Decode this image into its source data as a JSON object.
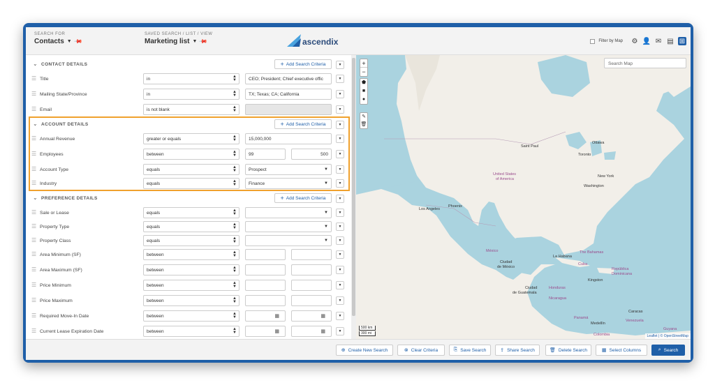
{
  "header": {
    "search_for_label": "SEARCH FOR",
    "search_for_value": "Contacts",
    "saved_search_label": "SAVED SEARCH / LIST / VIEW",
    "saved_search_value": "Marketing list",
    "logo_text": "ascendix",
    "filter_by_map": "Filter by Map"
  },
  "sections": {
    "contact": {
      "title": "CONTACT DETAILS",
      "add": "Add Search Criteria"
    },
    "account": {
      "title": "ACCOUNT DETAILS",
      "add": "Add Search Criteria"
    },
    "preference": {
      "title": "PREFERENCE DETAILS",
      "add": "Add Search Criteria"
    }
  },
  "rows": {
    "title": {
      "label": "Title",
      "op": "in",
      "value": "CEO; President; Chief executive offic"
    },
    "state": {
      "label": "Mailing State/Province",
      "op": "in",
      "value": "TX; Texas; CA; California"
    },
    "email": {
      "label": "Email",
      "op": "is not blank"
    },
    "revenue": {
      "label": "Annual Revenue",
      "op": "greater or equals",
      "value": "15,000,000"
    },
    "employees": {
      "label": "Employees",
      "op": "between",
      "from": "99",
      "to": "500"
    },
    "account_type": {
      "label": "Account Type",
      "op": "equals",
      "value": "Prospect"
    },
    "industry": {
      "label": "Industry",
      "op": "equals",
      "value": "Finance"
    },
    "sale_lease": {
      "label": "Sale or Lease",
      "op": "equals"
    },
    "property_type": {
      "label": "Property Type",
      "op": "equals"
    },
    "property_class": {
      "label": "Property Class",
      "op": "equals"
    },
    "area_min": {
      "label": "Area Minimum (SF)",
      "op": "between"
    },
    "area_max": {
      "label": "Area Maximum (SF)",
      "op": "between"
    },
    "price_min": {
      "label": "Price Minimum",
      "op": "between"
    },
    "price_max": {
      "label": "Price Maximum",
      "op": "between"
    },
    "move_in": {
      "label": "Required Move-In Date",
      "op": "between"
    },
    "lease_exp": {
      "label": "Current Lease Expiration Date",
      "op": "between"
    }
  },
  "map": {
    "search_placeholder": "Search Map",
    "labels": {
      "saint_paul": "Saint Paul",
      "ottawa": "Ottawa",
      "toronto": "Toronto",
      "usa": "United States",
      "usa2": "of America",
      "new_york": "New York",
      "washington": "Washington",
      "los_angeles": "Los Angeles",
      "phoenix": "Phoenix",
      "mexico": "México",
      "la_habana": "La Habana",
      "bahamas": "The Bahamas",
      "cuba": "Cuba",
      "ciudad_mexico": "Ciudad",
      "ciudad_mexico2": "de México",
      "republica": "República",
      "dominicana": "Dominicana",
      "kingston": "Kingston",
      "ciudad_guatemala": "Ciudad",
      "ciudad_guatemala2": "de Guatemala",
      "honduras": "Honduras",
      "nicaragua": "Nicaragua",
      "panama": "Panamá",
      "caracas": "Caracas",
      "venezuela": "Venezuela",
      "medellin": "Medellín",
      "colombia": "Colombia",
      "guyana": "Guyana"
    },
    "scale_km": "500 km",
    "scale_mi": "300 mi",
    "attribution": "Leaflet | © OpenStreetMap"
  },
  "footer": {
    "create": "Create New Search",
    "clear": "Clear Criteria",
    "save": "Save Search",
    "share": "Share Search",
    "delete": "Delete Search",
    "columns": "Select Columns",
    "search": "Search"
  }
}
